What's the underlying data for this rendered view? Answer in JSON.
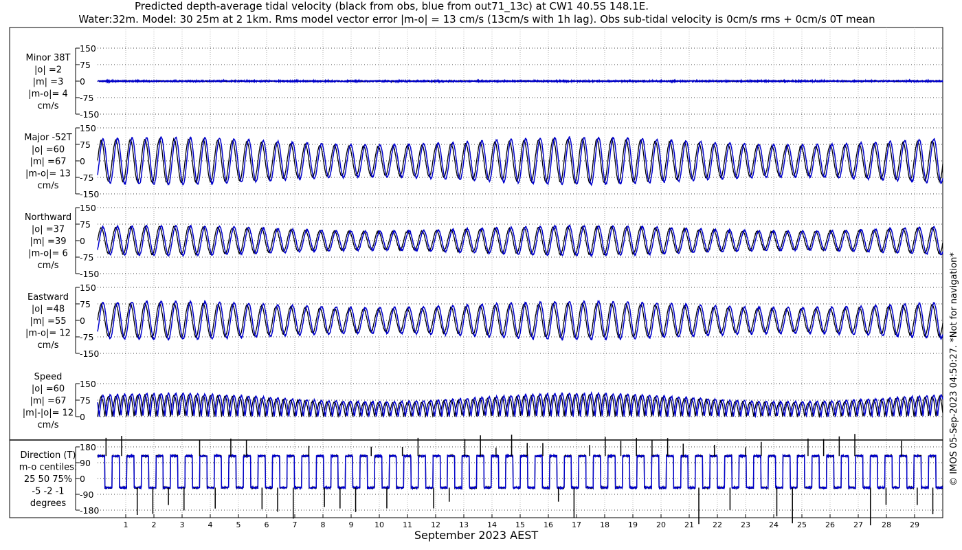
{
  "figure": {
    "title_line1": "Predicted depth-average tidal velocity (black from obs, blue from out71_13c) at CW1 40.5S 148.1E.",
    "title_line2": "Water:32m. Model: 30 25m at 2 1km. Rms model vector error |m-o| = 13 cm/s (13cm/s with 1h lag). Obs sub-tidal velocity is 0cm/s rms + 0cm/s 0T mean",
    "xlabel": "September 2023 AEST",
    "copyright": "© IMOS 05-Sep-2023 04:50:27. *Not for navigation*",
    "obs_color": "#000000",
    "model_color": "#0000cc",
    "grid_color": "#b0b0b0"
  },
  "chart_data": [
    {
      "type": "line",
      "panel": "minor",
      "label_lines": [
        "Minor 38T",
        "|o| =2",
        "|m| =3",
        "|m-o|= 4",
        "cm/s"
      ],
      "yticks": [
        "150",
        "75",
        "0",
        "-75",
        "-150"
      ],
      "ylim": [
        -150,
        150
      ],
      "xlim": [
        0,
        30
      ],
      "xticks": [
        "1",
        "2",
        "3",
        "4",
        "5",
        "6",
        "7",
        "8",
        "9",
        "10",
        "11",
        "12",
        "13",
        "14",
        "15",
        "16",
        "17",
        "18",
        "19",
        "20",
        "21",
        "22",
        "23",
        "24",
        "25",
        "26",
        "27",
        "28",
        "29"
      ],
      "series": [
        {
          "name": "obs",
          "kind": "noise",
          "amp": 2,
          "offset": 0
        },
        {
          "name": "model",
          "kind": "noise",
          "amp": 3,
          "offset": 0
        }
      ]
    },
    {
      "type": "line",
      "panel": "major",
      "label_lines": [
        "Major -52T",
        "|o| =60",
        "|m| =67",
        "|m-o|= 13",
        "cm/s"
      ],
      "yticks": [
        "150",
        "75",
        "0",
        "-75",
        "-150"
      ],
      "ylim": [
        -150,
        150
      ],
      "xlim": [
        0,
        30
      ],
      "series": [
        {
          "name": "obs",
          "kind": "tide",
          "amp_mean": 82,
          "amp_var": 16,
          "phase": 0.0
        },
        {
          "name": "model",
          "kind": "tide",
          "amp_mean": 90,
          "amp_var": 17,
          "phase": 0.06
        }
      ]
    },
    {
      "type": "line",
      "panel": "northward",
      "label_lines": [
        "Northward",
        "|o| =37",
        "|m| =39",
        "|m-o|= 6",
        "cm/s"
      ],
      "yticks": [
        "150",
        "75",
        "0",
        "-75",
        "-150"
      ],
      "ylim": [
        -150,
        150
      ],
      "xlim": [
        0,
        30
      ],
      "series": [
        {
          "name": "obs",
          "kind": "tide",
          "amp_mean": 52,
          "amp_var": 11,
          "phase": 0.0
        },
        {
          "name": "model",
          "kind": "tide",
          "amp_mean": 55,
          "amp_var": 12,
          "phase": 0.06
        }
      ]
    },
    {
      "type": "line",
      "panel": "eastward",
      "label_lines": [
        "Eastward",
        "|o| =48",
        "|m| =55",
        "|m-o|= 12",
        "cm/s"
      ],
      "yticks": [
        "150",
        "75",
        "0",
        "-75",
        "-150"
      ],
      "ylim": [
        -150,
        150
      ],
      "xlim": [
        0,
        30
      ],
      "series": [
        {
          "name": "obs",
          "kind": "tide",
          "amp_mean": 64,
          "amp_var": 13,
          "phase": 0.0
        },
        {
          "name": "model",
          "kind": "tide",
          "amp_mean": 72,
          "amp_var": 14,
          "phase": 0.06
        }
      ]
    },
    {
      "type": "line",
      "panel": "speed",
      "label_lines": [
        "Speed",
        "|o| =60",
        "|m| =67",
        "|m|-|o|= 12",
        "cm/s"
      ],
      "yticks": [
        "150",
        "75",
        "0"
      ],
      "ylim": [
        0,
        150
      ],
      "xlim": [
        0,
        30
      ],
      "series": [
        {
          "name": "obs",
          "kind": "speed",
          "amp_mean": 80,
          "amp_var": 18,
          "phase": 0.0
        },
        {
          "name": "model",
          "kind": "speed",
          "amp_mean": 86,
          "amp_var": 19,
          "phase": 0.06
        }
      ]
    },
    {
      "type": "line",
      "panel": "direction",
      "label_lines": [
        "Direction (T)",
        "m-o centiles:",
        "25  50  75%",
        "-5 -2 -1",
        "degrees"
      ],
      "yticks": [
        "180",
        "90",
        "0",
        "-90",
        "-180"
      ],
      "ylim": [
        -180,
        180
      ],
      "xlim": [
        0,
        30
      ],
      "series": [
        {
          "name": "obs",
          "kind": "direction",
          "high": 128,
          "low": -52
        },
        {
          "name": "model",
          "kind": "direction",
          "high": 128,
          "low": -52
        }
      ]
    }
  ]
}
